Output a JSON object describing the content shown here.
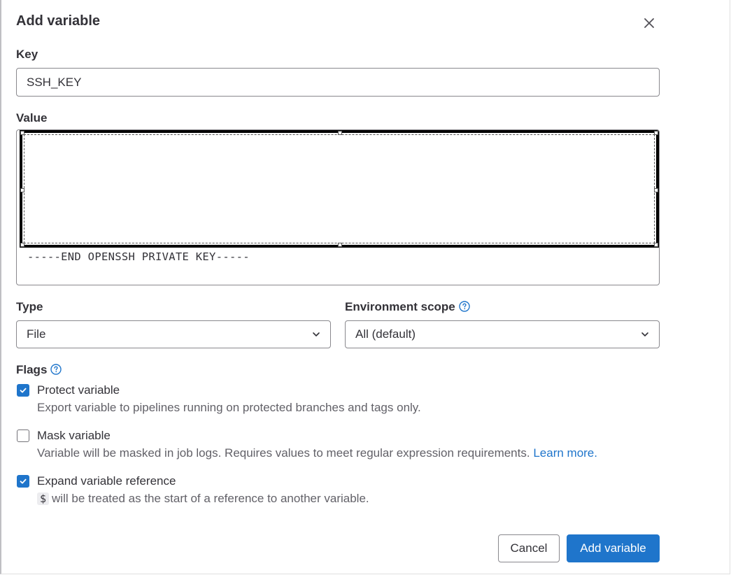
{
  "modal": {
    "title": "Add variable"
  },
  "key": {
    "label": "Key",
    "value": "SSH_KEY"
  },
  "value": {
    "label": "Value",
    "visible_text": "-----END OPENSSH PRIVATE KEY-----"
  },
  "type": {
    "label": "Type",
    "selected": "File"
  },
  "environment_scope": {
    "label": "Environment scope",
    "selected": "All (default)"
  },
  "flags": {
    "label": "Flags",
    "protect": {
      "label": "Protect variable",
      "help": "Export variable to pipelines running on protected branches and tags only.",
      "checked": true
    },
    "mask": {
      "label": "Mask variable",
      "help": "Variable will be masked in job logs. Requires values to meet regular expression requirements.",
      "link": "Learn more.",
      "checked": false
    },
    "expand": {
      "label": "Expand variable reference",
      "code": "$",
      "help": "will be treated as the start of a reference to another variable.",
      "checked": true
    }
  },
  "footer": {
    "cancel_label": "Cancel",
    "submit_label": "Add variable"
  },
  "colors": {
    "accent": "#1f75cb",
    "text": "#333238",
    "muted": "#626168",
    "border": "#89888d"
  },
  "icons": {
    "close": "close-icon",
    "help": "question-circle-icon",
    "chevron": "chevron-down-icon",
    "check": "check-icon"
  }
}
